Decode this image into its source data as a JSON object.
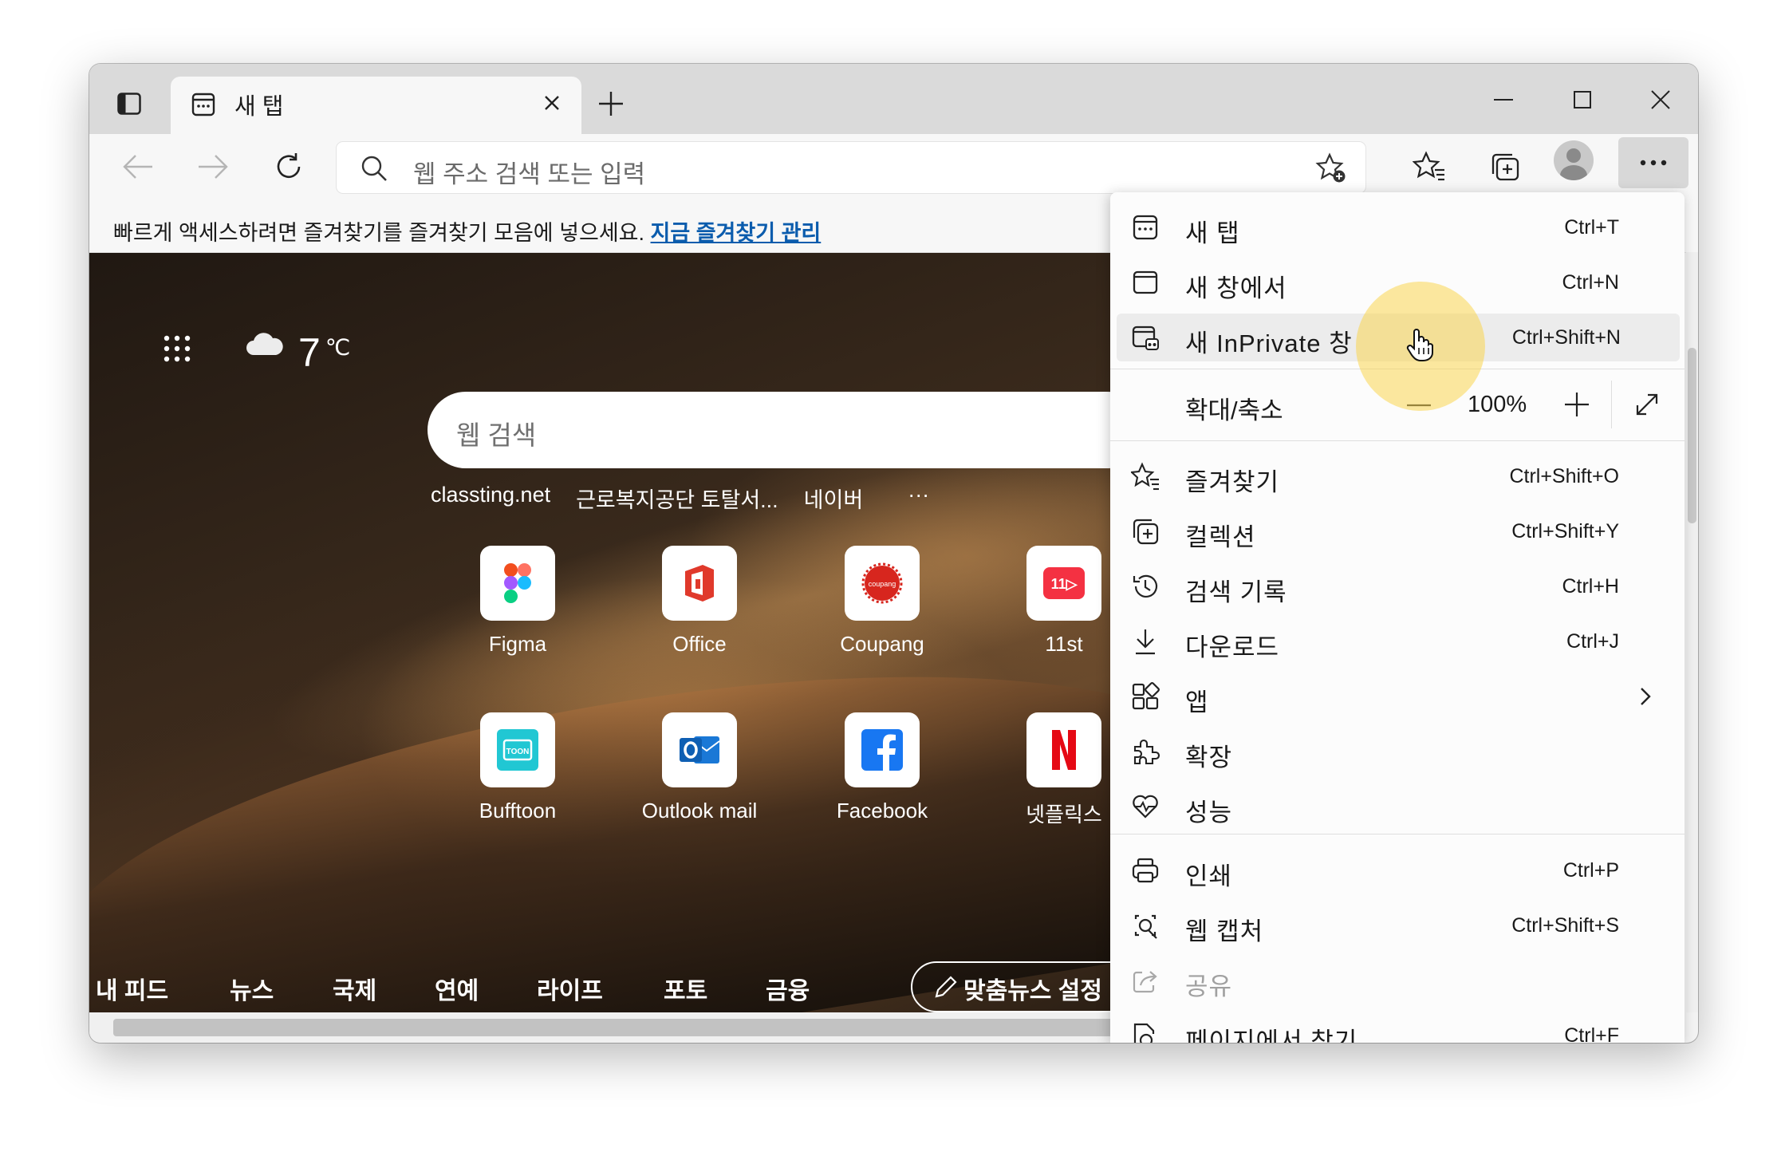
{
  "tab": {
    "title": "새 탭"
  },
  "address_bar": {
    "placeholder": "웹 주소 검색 또는 입력"
  },
  "favorites_bar": {
    "message": "빠르게 액세스하려면 즐겨찾기를 즐겨찾기 모음에 넣으세요.",
    "link": "지금 즐겨찾기 관리"
  },
  "newtab_page": {
    "weather": {
      "temp": "7",
      "unit": "℃"
    },
    "search_placeholder": "웹 검색",
    "quick_links": [
      "classting.net",
      "근로복지공단 토탈서...",
      "네이버",
      "···"
    ],
    "tiles": [
      {
        "label": "Figma",
        "icon": "figma-icon"
      },
      {
        "label": "Office",
        "icon": "office-icon"
      },
      {
        "label": "Coupang",
        "icon": "coupang-icon"
      },
      {
        "label": "11st",
        "icon": "11st-icon"
      },
      {
        "label": "Bufftoon",
        "icon": "bufftoon-icon"
      },
      {
        "label": "Outlook mail",
        "icon": "outlook-icon"
      },
      {
        "label": "Facebook",
        "icon": "facebook-icon"
      },
      {
        "label": "넷플릭스",
        "icon": "netflix-icon"
      }
    ],
    "feed_tabs": [
      "내 피드",
      "뉴스",
      "국제",
      "연예",
      "라이프",
      "포토",
      "금융"
    ],
    "custom_news": "맞춤뉴스 설정"
  },
  "menu": {
    "items": [
      {
        "label": "새 탭",
        "shortcut": "Ctrl+T",
        "icon": "new-tab-icon"
      },
      {
        "label": "새 창에서",
        "shortcut": "Ctrl+N",
        "icon": "new-window-icon"
      },
      {
        "label": "새 InPrivate 창",
        "shortcut": "Ctrl+Shift+N",
        "icon": "inprivate-icon"
      },
      {
        "label": "즐겨찾기",
        "shortcut": "Ctrl+Shift+O",
        "icon": "favorites-icon"
      },
      {
        "label": "컬렉션",
        "shortcut": "Ctrl+Shift+Y",
        "icon": "collections-icon"
      },
      {
        "label": "검색 기록",
        "shortcut": "Ctrl+H",
        "icon": "history-icon"
      },
      {
        "label": "다운로드",
        "shortcut": "Ctrl+J",
        "icon": "download-icon"
      },
      {
        "label": "앱",
        "shortcut": "",
        "icon": "apps-icon"
      },
      {
        "label": "확장",
        "shortcut": "",
        "icon": "extensions-icon"
      },
      {
        "label": "성능",
        "shortcut": "",
        "icon": "performance-icon"
      },
      {
        "label": "인쇄",
        "shortcut": "Ctrl+P",
        "icon": "print-icon"
      },
      {
        "label": "웹 캡처",
        "shortcut": "Ctrl+Shift+S",
        "icon": "web-capture-icon"
      },
      {
        "label": "공유",
        "shortcut": "",
        "icon": "share-icon"
      },
      {
        "label": "페이지에서 찾기",
        "shortcut": "Ctrl+F",
        "icon": "find-icon"
      }
    ],
    "zoom": {
      "label": "확대/축소",
      "value": "100%"
    }
  },
  "colors": {
    "accent_link": "#0b5cad",
    "cursor_highlight": "#fad650"
  }
}
